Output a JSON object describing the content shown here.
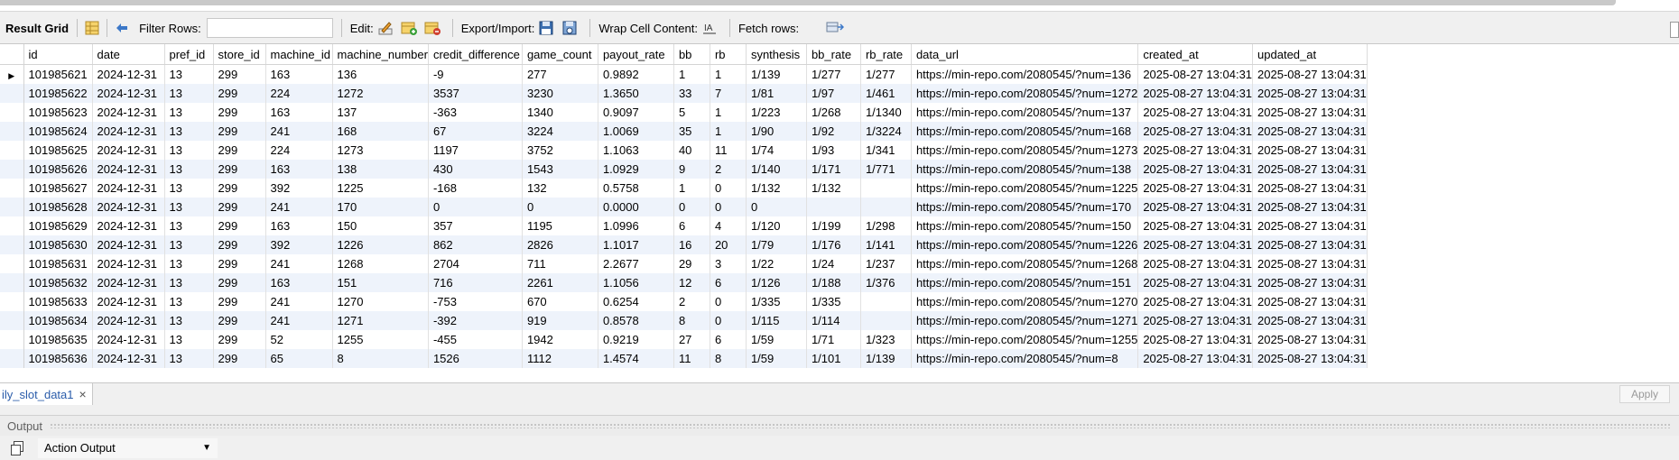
{
  "toolbar": {
    "result_grid_label": "Result Grid",
    "filter_rows_label": "Filter Rows:",
    "filter_value": "",
    "edit_label": "Edit:",
    "export_import_label": "Export/Import:",
    "wrap_cell_content_label": "Wrap Cell Content:",
    "fetch_rows_label": "Fetch rows:"
  },
  "grid": {
    "columns": [
      "id",
      "date",
      "pref_id",
      "store_id",
      "machine_id",
      "machine_number",
      "credit_difference",
      "game_count",
      "payout_rate",
      "bb",
      "rb",
      "synthesis",
      "bb_rate",
      "rb_rate",
      "data_url",
      "created_at",
      "updated_at"
    ],
    "rows": [
      [
        "101985621",
        "2024-12-31",
        "13",
        "299",
        "163",
        "136",
        "-9",
        "277",
        "0.9892",
        "1",
        "1",
        "1/139",
        "1/277",
        "1/277",
        "https://min-repo.com/2080545/?num=136",
        "2025-08-27 13:04:31",
        "2025-08-27 13:04:31"
      ],
      [
        "101985622",
        "2024-12-31",
        "13",
        "299",
        "224",
        "1272",
        "3537",
        "3230",
        "1.3650",
        "33",
        "7",
        "1/81",
        "1/97",
        "1/461",
        "https://min-repo.com/2080545/?num=1272",
        "2025-08-27 13:04:31",
        "2025-08-27 13:04:31"
      ],
      [
        "101985623",
        "2024-12-31",
        "13",
        "299",
        "163",
        "137",
        "-363",
        "1340",
        "0.9097",
        "5",
        "1",
        "1/223",
        "1/268",
        "1/1340",
        "https://min-repo.com/2080545/?num=137",
        "2025-08-27 13:04:31",
        "2025-08-27 13:04:31"
      ],
      [
        "101985624",
        "2024-12-31",
        "13",
        "299",
        "241",
        "168",
        "67",
        "3224",
        "1.0069",
        "35",
        "1",
        "1/90",
        "1/92",
        "1/3224",
        "https://min-repo.com/2080545/?num=168",
        "2025-08-27 13:04:31",
        "2025-08-27 13:04:31"
      ],
      [
        "101985625",
        "2024-12-31",
        "13",
        "299",
        "224",
        "1273",
        "1197",
        "3752",
        "1.1063",
        "40",
        "11",
        "1/74",
        "1/93",
        "1/341",
        "https://min-repo.com/2080545/?num=1273",
        "2025-08-27 13:04:31",
        "2025-08-27 13:04:31"
      ],
      [
        "101985626",
        "2024-12-31",
        "13",
        "299",
        "163",
        "138",
        "430",
        "1543",
        "1.0929",
        "9",
        "2",
        "1/140",
        "1/171",
        "1/771",
        "https://min-repo.com/2080545/?num=138",
        "2025-08-27 13:04:31",
        "2025-08-27 13:04:31"
      ],
      [
        "101985627",
        "2024-12-31",
        "13",
        "299",
        "392",
        "1225",
        "-168",
        "132",
        "0.5758",
        "1",
        "0",
        "1/132",
        "1/132",
        "",
        "https://min-repo.com/2080545/?num=1225",
        "2025-08-27 13:04:31",
        "2025-08-27 13:04:31"
      ],
      [
        "101985628",
        "2024-12-31",
        "13",
        "299",
        "241",
        "170",
        "0",
        "0",
        "0.0000",
        "0",
        "0",
        "0",
        "",
        "",
        "https://min-repo.com/2080545/?num=170",
        "2025-08-27 13:04:31",
        "2025-08-27 13:04:31"
      ],
      [
        "101985629",
        "2024-12-31",
        "13",
        "299",
        "163",
        "150",
        "357",
        "1195",
        "1.0996",
        "6",
        "4",
        "1/120",
        "1/199",
        "1/298",
        "https://min-repo.com/2080545/?num=150",
        "2025-08-27 13:04:31",
        "2025-08-27 13:04:31"
      ],
      [
        "101985630",
        "2024-12-31",
        "13",
        "299",
        "392",
        "1226",
        "862",
        "2826",
        "1.1017",
        "16",
        "20",
        "1/79",
        "1/176",
        "1/141",
        "https://min-repo.com/2080545/?num=1226",
        "2025-08-27 13:04:31",
        "2025-08-27 13:04:31"
      ],
      [
        "101985631",
        "2024-12-31",
        "13",
        "299",
        "241",
        "1268",
        "2704",
        "711",
        "2.2677",
        "29",
        "3",
        "1/22",
        "1/24",
        "1/237",
        "https://min-repo.com/2080545/?num=1268",
        "2025-08-27 13:04:31",
        "2025-08-27 13:04:31"
      ],
      [
        "101985632",
        "2024-12-31",
        "13",
        "299",
        "163",
        "151",
        "716",
        "2261",
        "1.1056",
        "12",
        "6",
        "1/126",
        "1/188",
        "1/376",
        "https://min-repo.com/2080545/?num=151",
        "2025-08-27 13:04:31",
        "2025-08-27 13:04:31"
      ],
      [
        "101985633",
        "2024-12-31",
        "13",
        "299",
        "241",
        "1270",
        "-753",
        "670",
        "0.6254",
        "2",
        "0",
        "1/335",
        "1/335",
        "",
        "https://min-repo.com/2080545/?num=1270",
        "2025-08-27 13:04:31",
        "2025-08-27 13:04:31"
      ],
      [
        "101985634",
        "2024-12-31",
        "13",
        "299",
        "241",
        "1271",
        "-392",
        "919",
        "0.8578",
        "8",
        "0",
        "1/115",
        "1/114",
        "",
        "https://min-repo.com/2080545/?num=1271",
        "2025-08-27 13:04:31",
        "2025-08-27 13:04:31"
      ],
      [
        "101985635",
        "2024-12-31",
        "13",
        "299",
        "52",
        "1255",
        "-455",
        "1942",
        "0.9219",
        "27",
        "6",
        "1/59",
        "1/71",
        "1/323",
        "https://min-repo.com/2080545/?num=1255",
        "2025-08-27 13:04:31",
        "2025-08-27 13:04:31"
      ],
      [
        "101985636",
        "2024-12-31",
        "13",
        "299",
        "65",
        "8",
        "1526",
        "1112",
        "1.4574",
        "11",
        "8",
        "1/59",
        "1/101",
        "1/139",
        "https://min-repo.com/2080545/?num=8",
        "2025-08-27 13:04:31",
        "2025-08-27 13:04:31"
      ]
    ]
  },
  "tabs": [
    {
      "label": "ily_slot_data1",
      "close": "×"
    }
  ],
  "apply_label": "Apply",
  "output": {
    "title": "Output",
    "selector_value": "Action Output"
  },
  "icons": {
    "grid_icon": "grid-icon",
    "refresh_icon": "refresh-icon",
    "edit_icon": "edit-pencil-icon",
    "add_row_icon": "add-row-icon",
    "delete_row_icon": "delete-row-icon",
    "export_icon": "export-icon",
    "import_icon": "import-icon",
    "wrap_icon": "wrap-text-icon",
    "fetch_icon": "fetch-rows-icon"
  }
}
